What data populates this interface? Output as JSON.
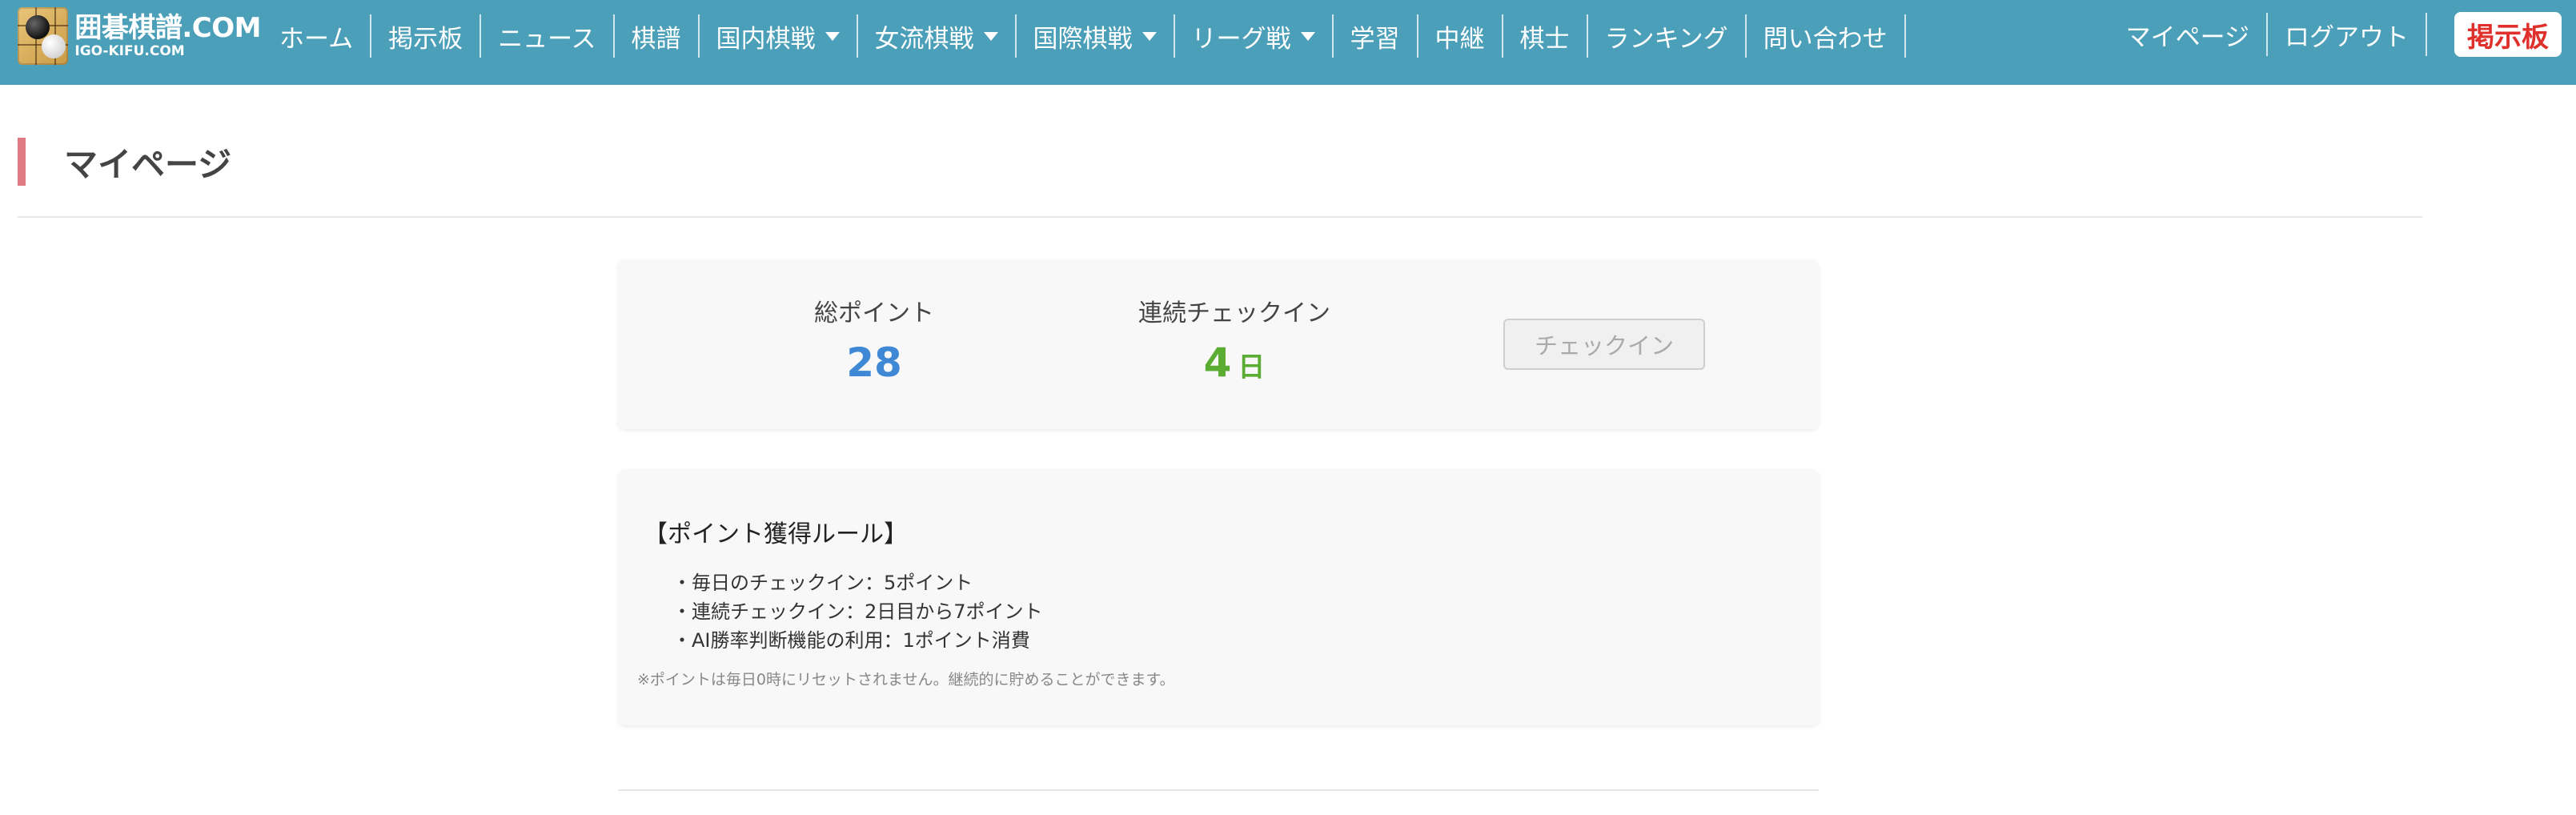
{
  "brand": {
    "logo_main": "囲碁棋譜.COM",
    "logo_sub": "IGO-KIFU.COM"
  },
  "nav": {
    "items": [
      {
        "label": "ホーム",
        "dropdown": false
      },
      {
        "label": "掲示板",
        "dropdown": false
      },
      {
        "label": "ニュース",
        "dropdown": false
      },
      {
        "label": "棋譜",
        "dropdown": false
      },
      {
        "label": "国内棋戦",
        "dropdown": true
      },
      {
        "label": "女流棋戦",
        "dropdown": true
      },
      {
        "label": "国際棋戦",
        "dropdown": true
      },
      {
        "label": "リーグ戦",
        "dropdown": true
      },
      {
        "label": "学習",
        "dropdown": false
      },
      {
        "label": "中継",
        "dropdown": false
      },
      {
        "label": "棋士",
        "dropdown": false
      },
      {
        "label": "ランキング",
        "dropdown": false
      },
      {
        "label": "問い合わせ",
        "dropdown": false
      }
    ],
    "right": {
      "mypage": "マイページ",
      "logout": "ログアウト",
      "board_button": "掲示板"
    }
  },
  "page": {
    "title": "マイページ"
  },
  "stats": {
    "points_label": "総ポイント",
    "points_value": "28",
    "streak_label": "連続チェックイン",
    "streak_value": "4",
    "streak_unit": "日",
    "checkin_button": "チェックイン"
  },
  "rules": {
    "title": "【ポイント獲得ルール】",
    "items": [
      "・毎日のチェックイン：5ポイント",
      "・連続チェックイン：2日目から7ポイント",
      "・AI勝率判断機能の利用：1ポイント消費"
    ],
    "note": "※ポイントは毎日0時にリセットされません。継続的に貯めることができます。"
  },
  "colors": {
    "navbar": "#4b9fb8",
    "heading_accent": "#e07b83",
    "points": "#3f88d6",
    "streak": "#5aac33",
    "board_button_text": "#e0302c"
  }
}
